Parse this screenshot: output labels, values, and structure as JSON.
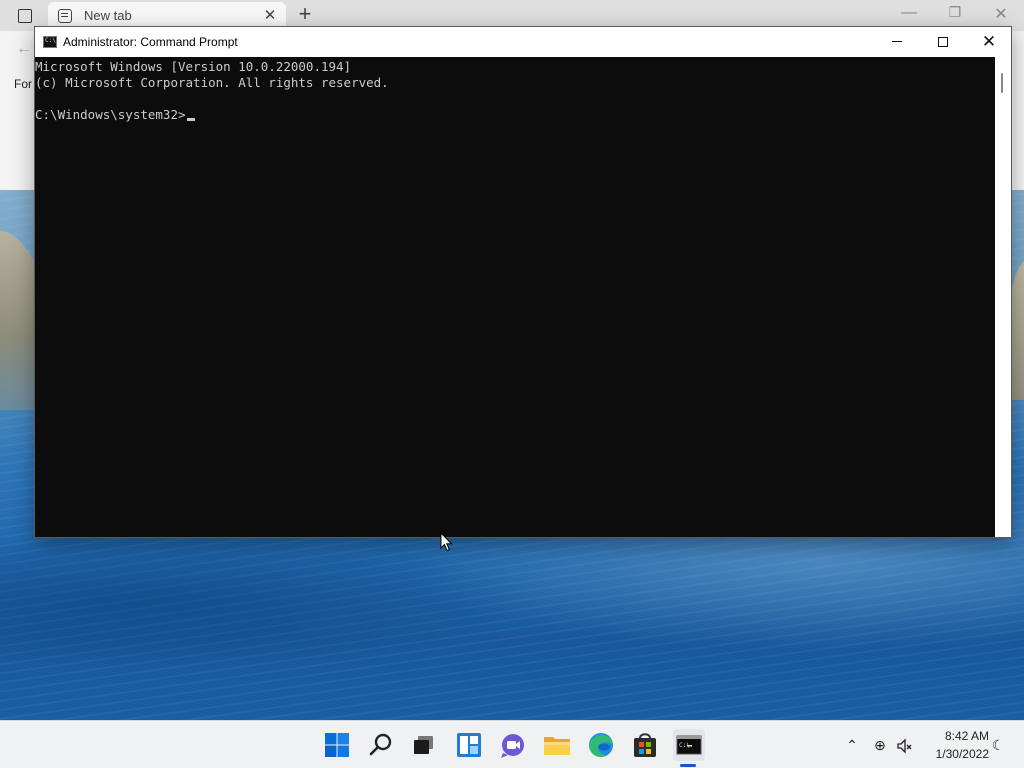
{
  "browser": {
    "tab_title": "New tab",
    "favorites_label": "For"
  },
  "cmd": {
    "title": "Administrator: Command Prompt",
    "lines": [
      "Microsoft Windows [Version 10.0.22000.194]",
      "(c) Microsoft Corporation. All rights reserved.",
      "",
      "C:\\Windows\\system32>"
    ]
  },
  "taskbar": {
    "icons": [
      "windows-start-icon",
      "search-icon",
      "task-view-icon",
      "widgets-icon",
      "chat-icon",
      "file-explorer-icon",
      "edge-icon",
      "store-icon",
      "command-prompt-icon"
    ],
    "active_app": "command-prompt",
    "tray": {
      "chevron_glyph": "⌃",
      "network_glyph": "⊕",
      "focus_glyph": "☾"
    },
    "clock": {
      "time": "8:42 AM",
      "date": "1/30/2022"
    }
  },
  "colors": {
    "console_bg": "#0c0c0c",
    "console_text": "#cccccc",
    "accent": "#0a5fc5"
  }
}
